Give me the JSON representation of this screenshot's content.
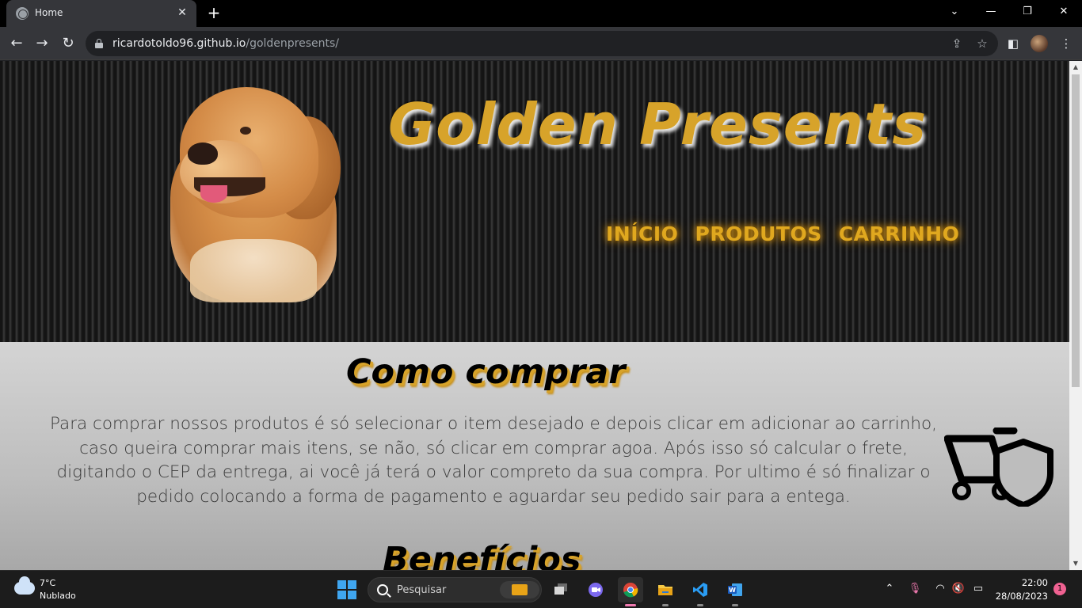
{
  "browser": {
    "tab_title": "Home",
    "tab_close": "✕",
    "new_tab": "+",
    "url_host": "ricardotoldo96.github.io",
    "url_path": "/goldenpresents/"
  },
  "site": {
    "title": "Golden Presents",
    "nav": [
      "INÍCIO",
      "PRODUTOS",
      "CARRINHO"
    ],
    "how_to_buy": {
      "heading": "Como comprar",
      "text": "Para comprar nossos produtos é só selecionar o item desejado e depois clicar em adicionar ao carrinho, caso queira comprar mais itens, se não, só clicar em comprar agoa. Após isso só calcular o frete, digitando o CEP da entrega, ai você já terá o valor compreto da sua compra. Por ultimo é só finalizar o pedido colocando a forma de pagamento e aguardar seu pedido sair para a entega."
    },
    "benefits": {
      "heading": "Benefícios"
    }
  },
  "taskbar": {
    "weather_temp": "7°C",
    "weather_desc": "Nublado",
    "search_placeholder": "Pesquisar",
    "time": "22:00",
    "date": "28/08/2023",
    "notifications": "1"
  },
  "colors": {
    "accent_gold": "#d7a32a",
    "nav_glow": "#e0a81f"
  }
}
